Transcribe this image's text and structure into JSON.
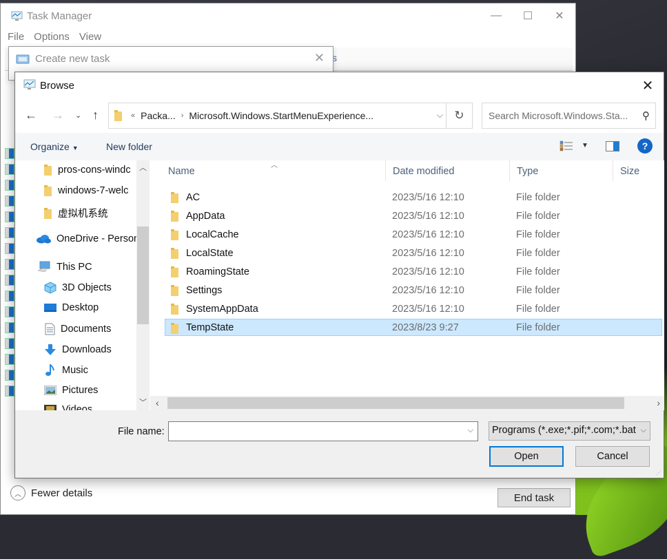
{
  "task_manager": {
    "title": "Task Manager",
    "menu": [
      "File",
      "Options",
      "View"
    ],
    "window_controls": [
      "minimize",
      "maximize",
      "close"
    ],
    "fewer_details": "Fewer details",
    "end_task": "End task",
    "tab_peek": "s"
  },
  "create_new_task": {
    "title": "Create new task"
  },
  "browse": {
    "title": "Browse",
    "address": {
      "overflow": "«",
      "segments": [
        "Packa...",
        "Microsoft.Windows.StartMenuExperience..."
      ]
    },
    "search_placeholder": "Search Microsoft.Windows.Sta...",
    "toolbar": {
      "organize": "Organize",
      "new_folder": "New folder"
    },
    "nav_pane": [
      {
        "label": "pros-cons-windc",
        "icon": "folder-icon"
      },
      {
        "label": "windows-7-welc",
        "icon": "folder-icon"
      },
      {
        "label": "虚拟机系统",
        "icon": "folder-icon"
      },
      {
        "label": "OneDrive - Person",
        "icon": "onedrive-icon"
      },
      {
        "label": "This PC",
        "icon": "computer-icon"
      },
      {
        "label": "3D Objects",
        "icon": "3d-objects-icon"
      },
      {
        "label": "Desktop",
        "icon": "desktop-icon"
      },
      {
        "label": "Documents",
        "icon": "documents-icon"
      },
      {
        "label": "Downloads",
        "icon": "downloads-icon"
      },
      {
        "label": "Music",
        "icon": "music-icon"
      },
      {
        "label": "Pictures",
        "icon": "pictures-icon"
      },
      {
        "label": "Videos",
        "icon": "videos-icon"
      }
    ],
    "columns": [
      "Name",
      "Date modified",
      "Type",
      "Size"
    ],
    "files": [
      {
        "name": "AC",
        "date": "2023/5/16 12:10",
        "type": "File folder"
      },
      {
        "name": "AppData",
        "date": "2023/5/16 12:10",
        "type": "File folder"
      },
      {
        "name": "LocalCache",
        "date": "2023/5/16 12:10",
        "type": "File folder"
      },
      {
        "name": "LocalState",
        "date": "2023/5/16 12:10",
        "type": "File folder"
      },
      {
        "name": "RoamingState",
        "date": "2023/5/16 12:10",
        "type": "File folder"
      },
      {
        "name": "Settings",
        "date": "2023/5/16 12:10",
        "type": "File folder"
      },
      {
        "name": "SystemAppData",
        "date": "2023/5/16 12:10",
        "type": "File folder"
      },
      {
        "name": "TempState",
        "date": "2023/8/23 9:27",
        "type": "File folder",
        "selected": true
      }
    ],
    "file_name_label": "File name:",
    "file_name_value": "",
    "file_type": "Programs (*.exe;*.pif;*.com;*.bat",
    "open": "Open",
    "cancel": "Cancel"
  }
}
